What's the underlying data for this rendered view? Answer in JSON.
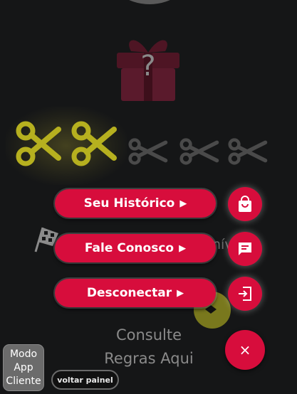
{
  "menu": {
    "history_label": "Seu Histórico",
    "contact_label": "Fale Conosco",
    "logout_label": "Desconectar",
    "arrow": "▶"
  },
  "background": {
    "gift_symbol": "?",
    "level_text": "nív 3.",
    "consult_line1": "Consulte",
    "consult_line2": "Regras Aqui"
  },
  "close": {
    "symbol": "×"
  },
  "mode_button": {
    "line1": "Modo",
    "line2": "App",
    "line3": "Cliente"
  },
  "back_button": {
    "label": "voltar painel"
  },
  "scissors": {
    "total": 5,
    "earned": 2
  },
  "colors": {
    "accent_red": "#d70d3c",
    "earned_yellow": "#b6b01f",
    "unearned_gray": "#4a4a4a",
    "gift_maroon": "#5a1a2c"
  }
}
